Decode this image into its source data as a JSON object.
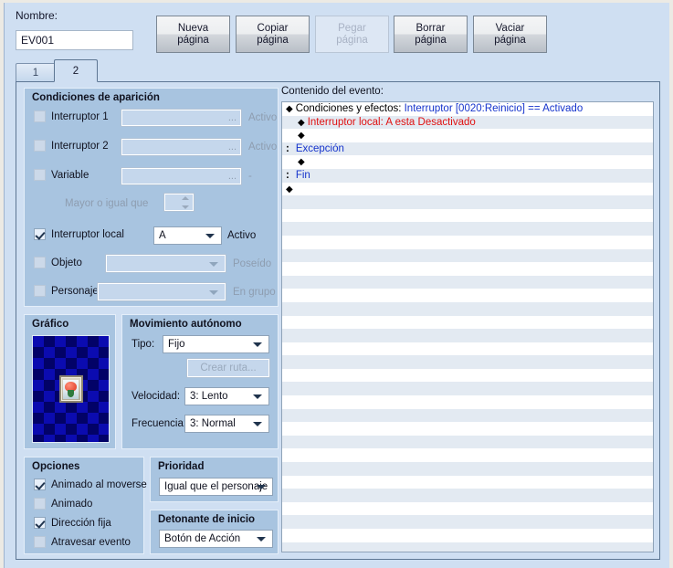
{
  "window": {
    "name_label": "Nombre:",
    "name_value": "EV001"
  },
  "toolbar": {
    "buttons": [
      {
        "label": "Nueva\npágina",
        "enabled": true
      },
      {
        "label": "Copiar\npágina",
        "enabled": true
      },
      {
        "label": "Pegar\npágina",
        "enabled": false
      },
      {
        "label": "Borrar\npágina",
        "enabled": true
      },
      {
        "label": "Vaciar\npágina",
        "enabled": true
      }
    ]
  },
  "tabs": [
    {
      "label": "1",
      "active": false
    },
    {
      "label": "2",
      "active": true
    }
  ],
  "conditions": {
    "title": "Condiciones de aparición",
    "switch1": {
      "label": "Interruptor 1",
      "checked": false,
      "value": "",
      "ellipsis": "...",
      "suffix": "Activo"
    },
    "switch2": {
      "label": "Interruptor 2",
      "checked": false,
      "value": "",
      "ellipsis": "...",
      "suffix": "Activo"
    },
    "variable": {
      "label": "Variable",
      "checked": false,
      "value": "",
      "ellipsis": "...",
      "suffix": "-"
    },
    "variable_cmp": {
      "label": "Mayor o igual que",
      "value": ""
    },
    "local_switch": {
      "label": "Interruptor local",
      "checked": true,
      "value": "A",
      "suffix": "Activo"
    },
    "item": {
      "label": "Objeto",
      "checked": false,
      "value": "",
      "suffix": "Poseído"
    },
    "actor": {
      "label": "Personaje",
      "checked": false,
      "value": "",
      "suffix": "En grupo"
    }
  },
  "graphic": {
    "title": "Gráfico"
  },
  "movement": {
    "title": "Movimiento autónomo",
    "type_label": "Tipo:",
    "type_value": "Fijo",
    "route_button": "Crear ruta...",
    "speed_label": "Velocidad:",
    "speed_value": "3: Lento",
    "freq_label": "Frecuencia:",
    "freq_value": "3: Normal"
  },
  "options": {
    "title": "Opciones",
    "items": [
      {
        "label": "Animado al moverse",
        "checked": true
      },
      {
        "label": "Animado",
        "checked": false
      },
      {
        "label": "Dirección fija",
        "checked": true
      },
      {
        "label": "Atravesar evento",
        "checked": false
      }
    ]
  },
  "priority": {
    "title": "Prioridad",
    "value": "Igual que el personaje"
  },
  "trigger": {
    "title": "Detonante de inicio",
    "value": "Botón de Acción"
  },
  "event_content": {
    "label": "Contenido del evento:",
    "rows": [
      {
        "marker": "diamond",
        "indent": 0,
        "prefix": "Condiciones y efectos:",
        "text": " Interruptor [0020:Reinicio] == Activado",
        "color": "blue"
      },
      {
        "marker": "diamond",
        "indent": 1,
        "prefix": "",
        "text": "Interruptor local: A esta Desactivado",
        "color": "red"
      },
      {
        "marker": "diamond",
        "indent": 1,
        "prefix": "",
        "text": "",
        "color": "blue"
      },
      {
        "marker": "colon",
        "indent": 0,
        "prefix": "",
        "text": "Excepción",
        "color": "blue"
      },
      {
        "marker": "diamond",
        "indent": 1,
        "prefix": "",
        "text": "",
        "color": "blue"
      },
      {
        "marker": "colon",
        "indent": 0,
        "prefix": "",
        "text": "Fin",
        "color": "blue"
      },
      {
        "marker": "diamond",
        "indent": 0,
        "prefix": "",
        "text": "",
        "color": "blue"
      }
    ],
    "empty_rows": 27
  },
  "colors": {
    "dialog_bg": "#cfdff2",
    "group_bg": "#a8c4e0",
    "list_alt": "#e3eaf2",
    "link_blue": "#1533cc",
    "error_red": "#e01010"
  }
}
